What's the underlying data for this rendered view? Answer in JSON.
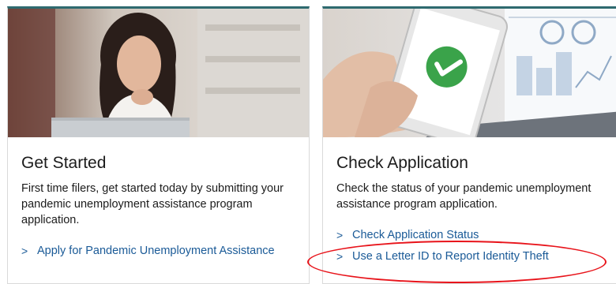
{
  "cards": [
    {
      "title": "Get Started",
      "description": "First time filers, get started today by submitting your pandemic unemployment assistance program application.",
      "links": [
        {
          "chevron": ">",
          "label": "Apply for Pandemic Unemployment Assistance"
        }
      ]
    },
    {
      "title": "Check Application",
      "description": "Check the status of your pandemic unemployment assistance program application.",
      "links": [
        {
          "chevron": ">",
          "label": "Check Application Status"
        },
        {
          "chevron": ">",
          "label": "Use a Letter ID to Report Identity Theft"
        }
      ]
    }
  ],
  "colors": {
    "card_top_border": "#2e6a6f",
    "link": "#1a5a97",
    "highlight_ellipse": "#e8141b",
    "checkmark_green": "#3aa34a"
  }
}
